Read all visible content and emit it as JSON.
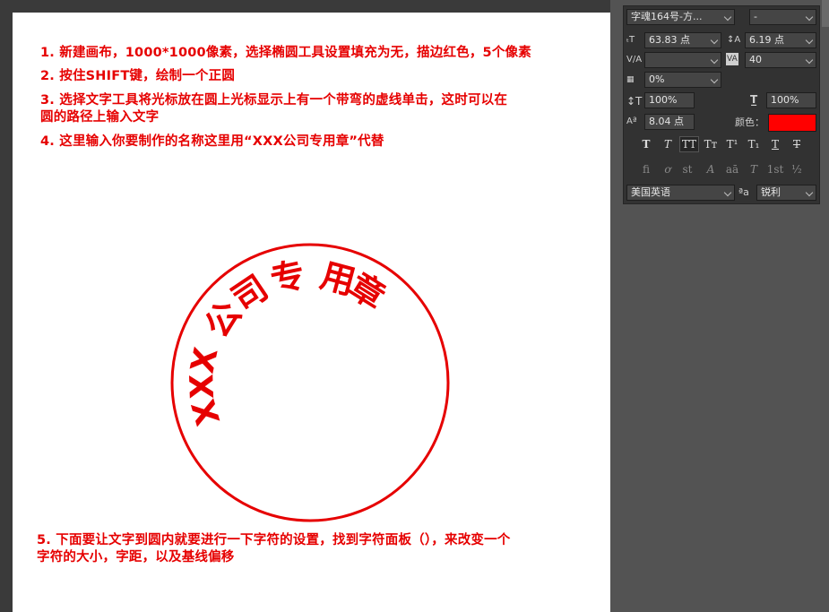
{
  "instructions": [
    "1. 新建画布，1000*1000像素，选择椭圆工具设置填充为无，描边红色，5个像素",
    "2. 按住SHIFT键，绘制一个正圆",
    "3. 选择文字工具将光标放在圆上光标显示上有一个带弯的虚线单击，这时可以在\n圆的路径上输入文字",
    "4. 这里输入你要制作的名称这里用“XXX公司专用章”代替",
    "5. 下面要让文字到圆内就要进行一下字符的设置，找到字符面板（），来改变一个\n字符的大小，字距，以及基线偏移"
  ],
  "stamp": {
    "chars": [
      "X",
      "X",
      "X",
      "公",
      "司",
      "专",
      "用",
      "章"
    ],
    "color": "#e60000"
  },
  "character_panel": {
    "font_family": "字魂164号-方...",
    "font_style": "-",
    "font_size_value": "63.83 点",
    "leading_value": "6.19 点",
    "kerning_value": "",
    "tracking_value": "40",
    "tsume_value": "0%",
    "vertical_scale_value": "100%",
    "horizontal_scale_value": "100%",
    "baseline_shift_value": "8.04 点",
    "color_label": "颜色：",
    "color_value": "#ff0000",
    "style_buttons": [
      "T",
      "T",
      "TT",
      "Tт",
      "T¹",
      "T₁",
      "T",
      "T"
    ],
    "opentype_buttons": [
      "fi",
      "ơ",
      "st",
      "A",
      "aā",
      "T",
      "1st",
      "½"
    ],
    "language": "美国英语",
    "aa_label": "ªa",
    "antialias": "锐利"
  }
}
